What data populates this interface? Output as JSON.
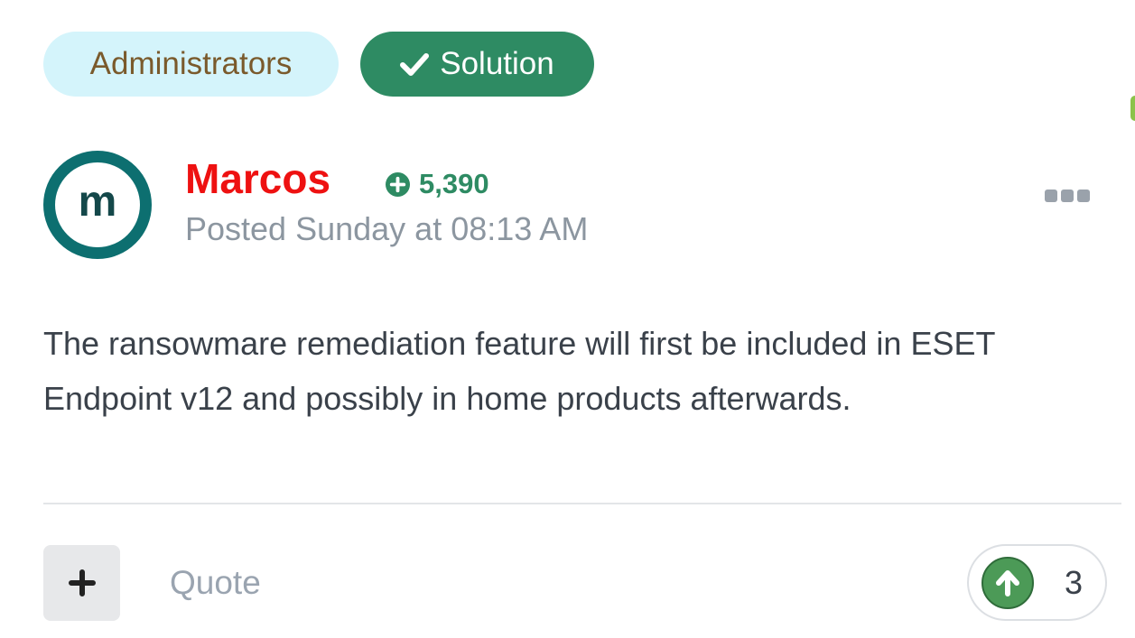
{
  "badges": {
    "group_label": "Administrators",
    "solution_label": "Solution"
  },
  "post": {
    "avatar_letter": "m",
    "author": "Marcos",
    "reputation": "5,390",
    "posted": "Posted Sunday at 08:13 AM",
    "content": "The ransowmare remediation feature will first be included in ESET Endpoint v12 and possibly in home products afterwards."
  },
  "footer": {
    "quote_label": "Quote",
    "reaction_count": "3"
  },
  "colors": {
    "author": "#ee1111",
    "accent_green": "#2e8b63",
    "admin_badge_bg": "#d4f4fb",
    "avatar_ring": "#0d6f70",
    "upvote": "#4c9a57"
  },
  "icons": {
    "solution": "check-icon",
    "reputation": "plus-circle-icon",
    "menu": "ellipsis-icon",
    "multiquote": "plus-icon",
    "reaction": "arrow-up-icon"
  }
}
